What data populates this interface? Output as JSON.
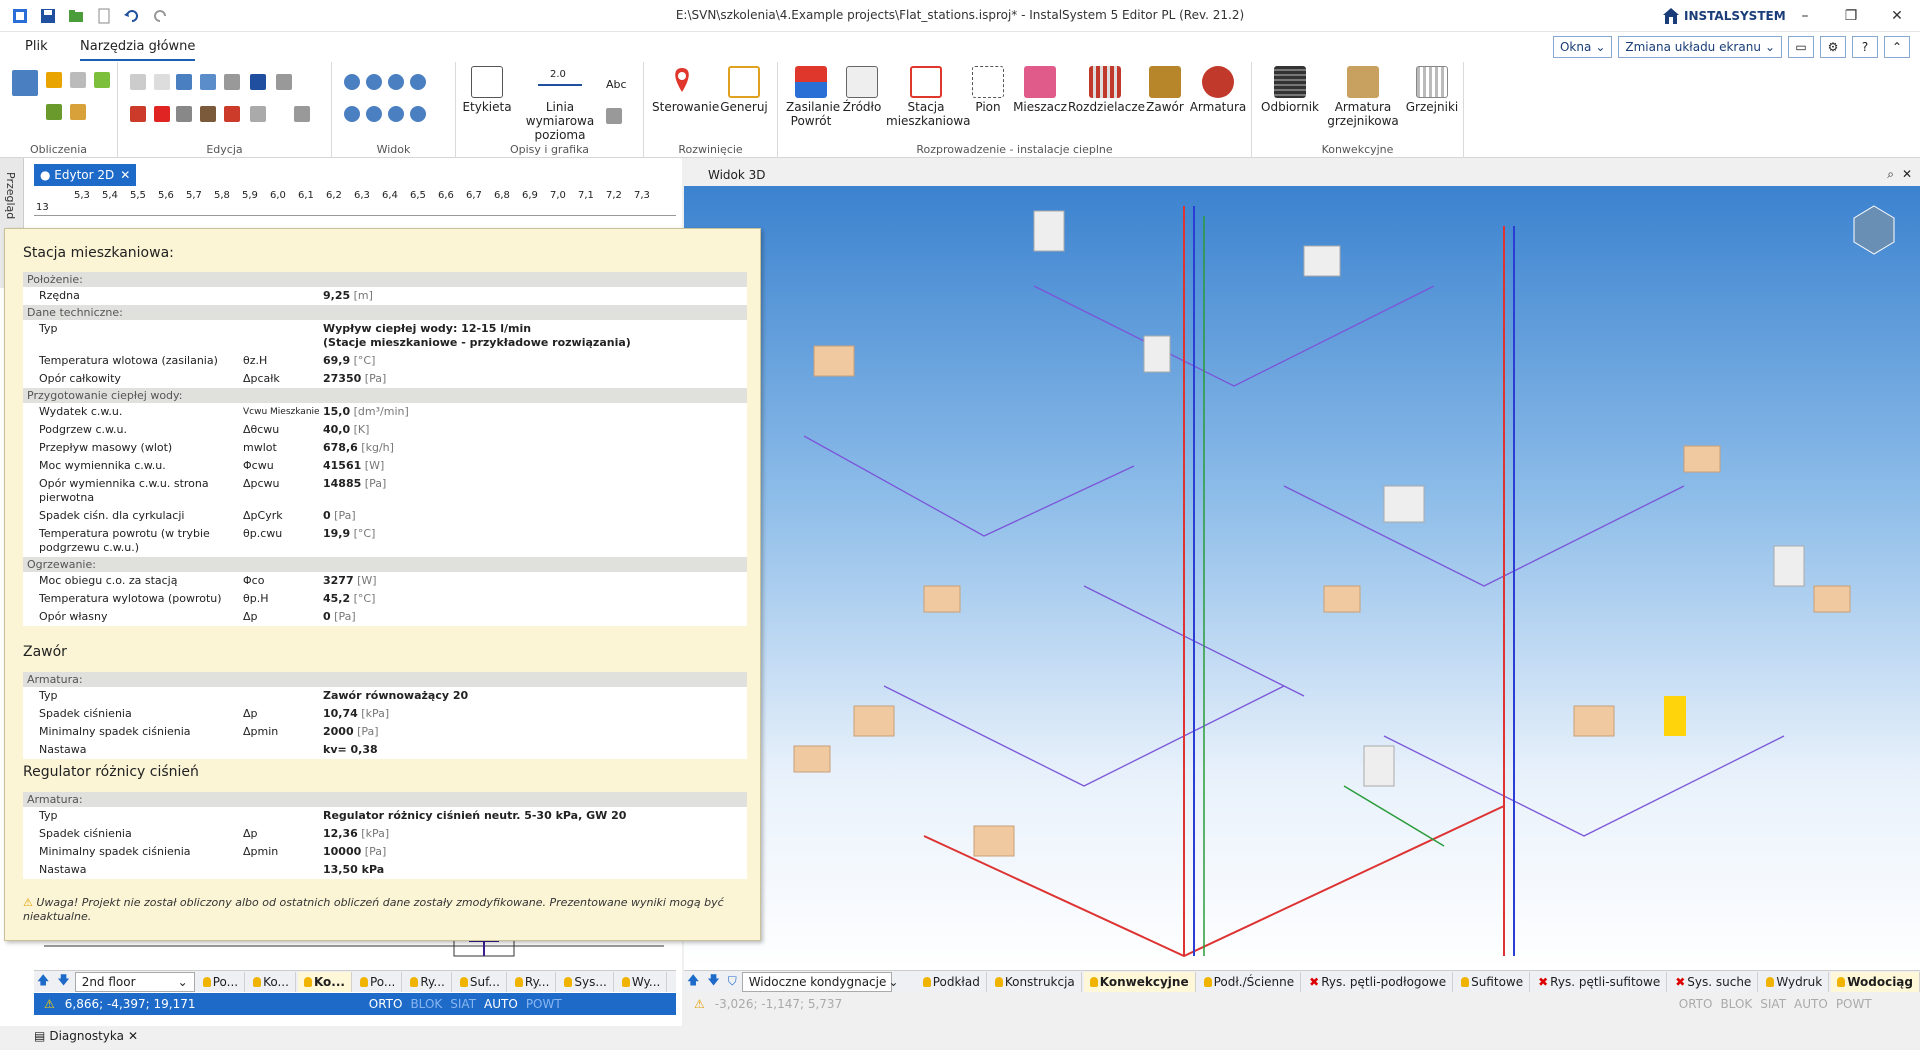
{
  "titlebar": {
    "title": "E:\\SVN\\szkolenia\\4.Example projects\\Flat_stations.isproj* - InstalSystem 5 Editor PL (Rev. 21.2)",
    "brand": "INSTALSYSTEM",
    "controls": [
      "–",
      "❐",
      "✕"
    ]
  },
  "menu": {
    "file": "Plik",
    "main_tools": "Narzędzia główne",
    "windows": "Okna",
    "layout_change": "Zmiana układu ekranu"
  },
  "ribbon": {
    "groups": {
      "calc": "Obliczenia",
      "edit": "Edycja",
      "view": "Widok",
      "desc": "Opisy i grafika",
      "dev": "Rozwinięcie",
      "dist": "Rozprowadzenie - instalacje cieplne",
      "conv": "Konwekcyjne"
    },
    "buttons": {
      "label": "Etykieta",
      "dimline_1": "Linia wymiarowa",
      "dimline_2": "pozioma",
      "dimline_val": "2.0",
      "abc": "Abc",
      "control": "Sterowanie",
      "generate": "Generuj",
      "supply_1": "Zasilanie",
      "supply_2": "Powrót",
      "source": "Źródło",
      "station_1": "Stacja",
      "station_2": "mieszkaniowa",
      "riser": "Pion",
      "mixer": "Mieszacz",
      "manifolds": "Rozdzielacze",
      "valve": "Zawór",
      "fittings": "Armatura",
      "receiver": "Odbiornik",
      "rad_fit_1": "Armatura",
      "rad_fit_2": "grzejnikowa",
      "radiators": "Grzejniki"
    }
  },
  "editor2d": {
    "side_tab": "Przegląd",
    "tab": "● Edytor 2D",
    "ruler_ticks": [
      "5,3",
      "5,4",
      "5,5",
      "5,6",
      "5,7",
      "5,8",
      "5,9",
      "6,0",
      "6,1",
      "6,2",
      "6,3",
      "6,4",
      "6,5",
      "6,6",
      "6,7",
      "6,8",
      "6,9",
      "7,0",
      "7,1",
      "7,2",
      "7,3"
    ],
    "ruler_side": "13",
    "floor": "2nd floor",
    "layers": [
      "Po...",
      "Ko...",
      "Ko...",
      "Po...",
      "Ry...",
      "Suf...",
      "Ry...",
      "Sys...",
      "Wy..."
    ],
    "coords": "6,866; -4,397; 19,171",
    "modes": [
      "ORTO",
      "BLOK",
      "SIAT",
      "AUTO",
      "POWT"
    ],
    "diag": "Diagnostyka"
  },
  "popup": {
    "s1_title": "Stacja mieszkaniowa:",
    "g_position": "Położenie:",
    "r_ordinate": {
      "name": "Rzędna",
      "sym": "",
      "val": "9,25",
      "unit": "[m]"
    },
    "g_tech": "Dane techniczne:",
    "r_type": {
      "name": "Typ",
      "val1": "Wypływ ciepłej wody: 12-15 l/min",
      "val2": "(Stacje mieszkaniowe - przykładowe rozwiązania)"
    },
    "r_tin": {
      "name": "Temperatura wlotowa (zasilania)",
      "sym": "θz.H",
      "val": "69,9",
      "unit": "[°C]"
    },
    "r_res": {
      "name": "Opór całkowity",
      "sym": "Δpcałk",
      "val": "27350",
      "unit": "[Pa]"
    },
    "g_dhw": "Przygotowanie ciepłej wody:",
    "r_flow": {
      "name": "Wydatek c.w.u.",
      "sym": "Vcwu Mieszkanie",
      "val": "15,0",
      "unit": "[dm³/min]"
    },
    "r_heat": {
      "name": "Podgrzew c.w.u.",
      "sym": "Δθcwu",
      "val": "40,0",
      "unit": "[K]"
    },
    "r_mass": {
      "name": "Przepływ masowy (wlot)",
      "sym": "mwlot",
      "val": "678,6",
      "unit": "[kg/h]"
    },
    "r_power": {
      "name": "Moc wymiennika c.w.u.",
      "sym": "Φcwu",
      "val": "41561",
      "unit": "[W]"
    },
    "r_exres_1": "Opór wymiennika c.w.u. strona",
    "r_exres_2": "pierwotna",
    "r_exres": {
      "sym": "Δpcwu",
      "val": "14885",
      "unit": "[Pa]"
    },
    "r_circ": {
      "name": "Spadek ciśn. dla cyrkulacji",
      "sym": "ΔpCyrk",
      "val": "0",
      "unit": "[Pa]"
    },
    "r_ret_1": "Temperatura powrotu (w trybie",
    "r_ret_2": "podgrzewu c.w.u.)",
    "r_ret": {
      "sym": "θp.cwu",
      "val": "19,9",
      "unit": "[°C]"
    },
    "g_heating": "Ogrzewanie:",
    "r_chpow": {
      "name": "Moc obiegu c.o. za stacją",
      "sym": "Φco",
      "val": "3277",
      "unit": "[W]"
    },
    "r_tout": {
      "name": "Temperatura wylotowa (powrotu)",
      "sym": "θp.H",
      "val": "45,2",
      "unit": "[°C]"
    },
    "r_own": {
      "name": "Opór własny",
      "sym": "Δp",
      "val": "0",
      "unit": "[Pa]"
    },
    "s2_title": "Zawór",
    "g_fit": "Armatura:",
    "v_type": {
      "name": "Typ",
      "val": "Zawór równoważący 20"
    },
    "v_dp": {
      "name": "Spadek ciśnienia",
      "sym": "Δp",
      "val": "10,74",
      "unit": "[kPa]"
    },
    "v_min": {
      "name": "Minimalny spadek ciśnienia",
      "sym": "Δpmin",
      "val": "2000",
      "unit": "[Pa]"
    },
    "v_set": {
      "name": "Nastawa",
      "val": "kv= 0,38"
    },
    "s3_title": "Regulator różnicy ciśnień",
    "g_fit2": "Armatura:",
    "p_type": {
      "name": "Typ",
      "val": "Regulator różnicy ciśnień neutr. 5-30 kPa, GW 20"
    },
    "p_dp": {
      "name": "Spadek ciśnienia",
      "sym": "Δp",
      "val": "12,36",
      "unit": "[kPa]"
    },
    "p_min": {
      "name": "Minimalny spadek ciśnienia",
      "sym": "Δpmin",
      "val": "10000",
      "unit": "[Pa]"
    },
    "p_set": {
      "name": "Nastawa",
      "val": "13,50 kPa"
    },
    "warning": "Uwaga! Projekt nie został obliczony albo od ostatnich obliczeń dane zostały zmodyfikowane. Prezentowane wyniki mogą być nieaktualne."
  },
  "view3d": {
    "title": "Widok 3D",
    "visible": "Widoczne kondygnacje",
    "layers": [
      {
        "label": "Podkład",
        "on": true
      },
      {
        "label": "Konstrukcja",
        "on": true
      },
      {
        "label": "Konwekcyjne",
        "on": true,
        "active": true
      },
      {
        "label": "Podł./Ścienne",
        "on": true
      },
      {
        "label": "Rys. pętli-podłogowe",
        "on": false
      },
      {
        "label": "Sufitowe",
        "on": true
      },
      {
        "label": "Rys. pętli-sufitowe",
        "on": false
      },
      {
        "label": "Sys. suche",
        "on": false
      },
      {
        "label": "Wydruk",
        "on": true
      },
      {
        "label": "Wodociąg",
        "on": true
      }
    ],
    "coords": "-3,026; -1,147; 5,737",
    "modes": [
      "ORTO",
      "BLOK",
      "SIAT",
      "AUTO",
      "POWT"
    ]
  }
}
